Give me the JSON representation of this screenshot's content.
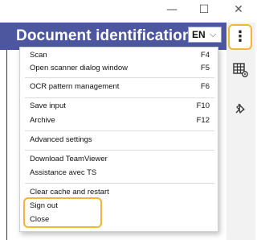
{
  "window": {
    "minimize": "—",
    "maximize": "☐",
    "close": "✕"
  },
  "header": {
    "title": "Document identification",
    "language": "EN",
    "menu_button": "⋮"
  },
  "side_icons": [
    {
      "name": "table-settings-icon",
      "glyph": "▦"
    },
    {
      "name": "pin-icon",
      "glyph": "📌"
    }
  ],
  "menu": {
    "items": [
      {
        "label": "Scan",
        "shortcut": "F4"
      },
      {
        "label": "Open scanner dialog window",
        "shortcut": "F5"
      },
      {
        "label": "OCR pattern management",
        "shortcut": "F6"
      },
      {
        "label": "Save input",
        "shortcut": "F10"
      },
      {
        "label": "Archive",
        "shortcut": "F12"
      },
      {
        "label": "Advanced settings",
        "shortcut": ""
      },
      {
        "label": "Download TeamViewer",
        "shortcut": ""
      },
      {
        "label": "Assistance avec TS",
        "shortcut": ""
      },
      {
        "label": "Clear cache and restart",
        "shortcut": ""
      },
      {
        "label": "Sign out",
        "shortcut": ""
      },
      {
        "label": "Close",
        "shortcut": ""
      }
    ]
  },
  "colors": {
    "header": "#4c57a0",
    "highlight": "#f3b634"
  }
}
